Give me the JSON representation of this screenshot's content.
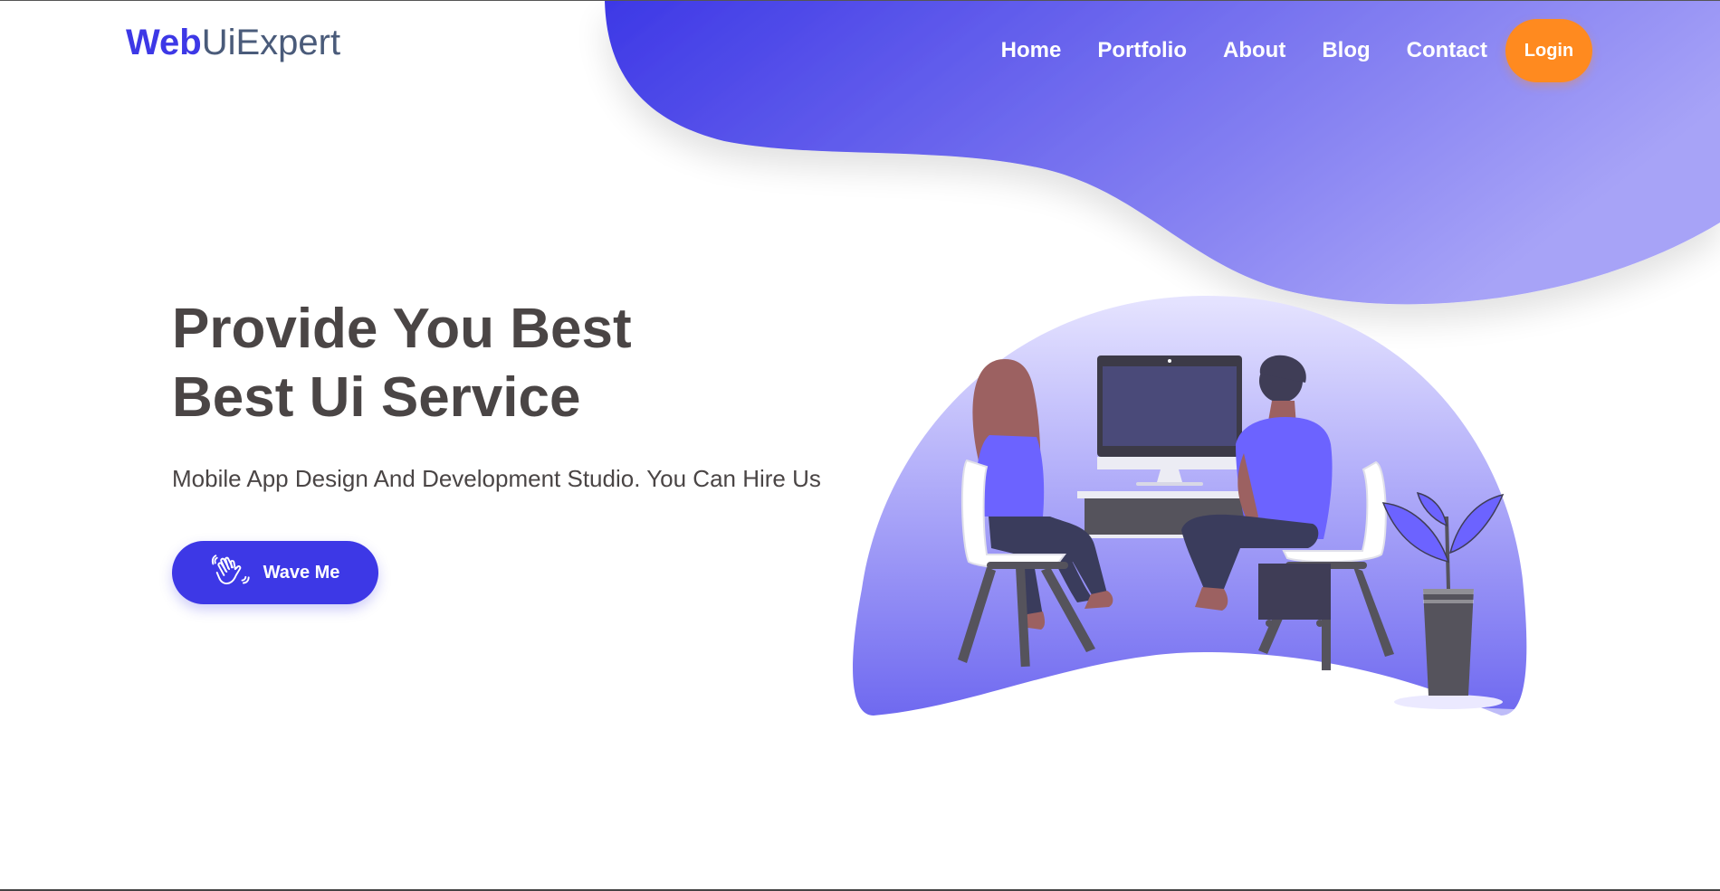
{
  "brand": {
    "logo_strong": "Web",
    "logo_rest": "UiExpert"
  },
  "nav": {
    "items": [
      {
        "label": "Home"
      },
      {
        "label": "Portfolio"
      },
      {
        "label": "About"
      },
      {
        "label": "Blog"
      },
      {
        "label": "Contact"
      }
    ],
    "login_label": "Login"
  },
  "hero": {
    "title_line1": "Provide You Best",
    "title_line2": "Best Ui Service",
    "subtitle": "Mobile App Design And Development Studio. You Can Hire Us",
    "cta_label": "Wave Me",
    "cta_icon": "waving-hand-icon"
  },
  "illustration": {
    "subject": "two-people-at-computer-illustration",
    "plant_icon": "potted-plant-icon"
  },
  "colors": {
    "primary": "#3d38e6",
    "accent": "#ff8a1f",
    "blob_gradient_start": "#3d38e6",
    "blob_gradient_end": "#a7a3f7",
    "text_dark": "#4a4545",
    "logo_rest": "#4a5b7a"
  }
}
